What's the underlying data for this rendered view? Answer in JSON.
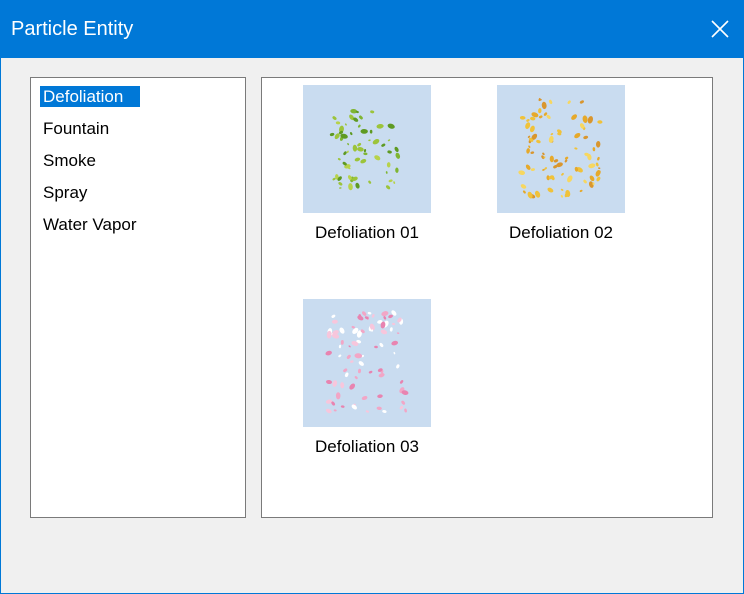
{
  "window": {
    "title": "Particle Entity"
  },
  "categories": [
    {
      "label": "Defoliation",
      "selected": true
    },
    {
      "label": "Fountain",
      "selected": false
    },
    {
      "label": "Smoke",
      "selected": false
    },
    {
      "label": "Spray",
      "selected": false
    },
    {
      "label": "Water Vapor",
      "selected": false
    }
  ],
  "gallery": {
    "items": [
      {
        "label": "Defoliation 01",
        "palette": [
          "#7fb532",
          "#9cc43a",
          "#5e9a22",
          "#b7d24a"
        ]
      },
      {
        "label": "Defoliation 02",
        "palette": [
          "#f0c23a",
          "#e6a92a",
          "#f7d760",
          "#d9962e"
        ]
      },
      {
        "label": "Defoliation 03",
        "palette": [
          "#f2a6c6",
          "#e884b0",
          "#ffffff",
          "#f7c6dc"
        ]
      }
    ]
  },
  "colors": {
    "accent": "#0078d7",
    "thumb_bg": "#c9dcf0"
  }
}
